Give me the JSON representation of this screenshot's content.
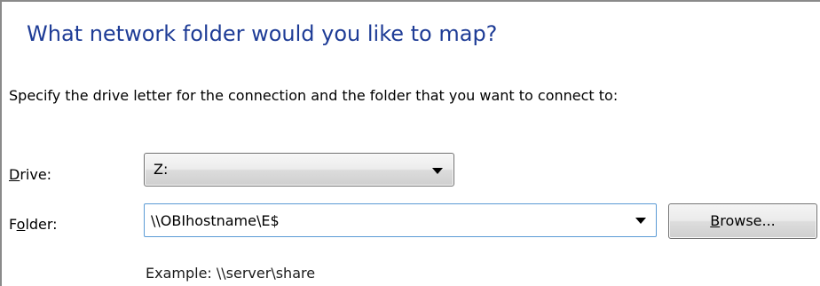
{
  "dialog": {
    "heading": "What network folder would you like to map?",
    "instructions": "Specify the drive letter for the connection and the folder that you want to connect to:"
  },
  "drive": {
    "label_accel": "D",
    "label_rest": "rive:",
    "selected": "Z:",
    "dropdown_icon": "chevron-down-icon"
  },
  "folder": {
    "label_pre": "F",
    "label_accel": "o",
    "label_post": "lder:",
    "value": "\\\\OBIhostname\\E$",
    "dropdown_icon": "chevron-down-icon"
  },
  "browse_button": {
    "accel": "B",
    "rest": "rowse..."
  },
  "example": "Example: \\\\server\\share",
  "colors": {
    "heading": "#1e3c96",
    "focus_border": "#5b9bd5",
    "frame_border": "#8a8a8a"
  }
}
